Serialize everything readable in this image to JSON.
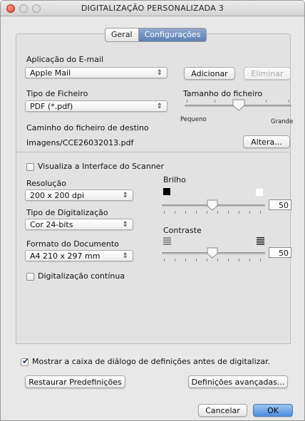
{
  "window": {
    "title": "DIGITALIZAÇÃO PERSONALIZADA 3"
  },
  "tabs": [
    {
      "label": "Geral",
      "active": false
    },
    {
      "label": "Configurações",
      "active": true
    }
  ],
  "email_app": {
    "label": "Aplicação do E-mail",
    "selected": "Apple Mail",
    "add_button": "Adicionar",
    "remove_button": "Eliminar"
  },
  "file_type": {
    "label": "Tipo de Ficheiro",
    "selected": "PDF (*.pdf)"
  },
  "file_size": {
    "label": "Tamanho do ficheiro",
    "min_label": "Pequeno",
    "max_label": "Grande",
    "level": 0.5
  },
  "destination": {
    "label": "Caminho do ficheiro de destino",
    "path": "Imagens/CCE26032013.pdf",
    "change_button": "Altera..."
  },
  "scanner_ui": {
    "label": "Visualiza a Interface do Scanner",
    "checked": false
  },
  "resolution": {
    "label": "Resolução",
    "selected": "200 x 200 dpi"
  },
  "scan_type": {
    "label": "Tipo de Digitalização",
    "selected": "Cor 24-bits"
  },
  "document_size": {
    "label": "Formato do Documento",
    "selected": "A4 210 x 297 mm"
  },
  "continuous_scan": {
    "label": "Digitalização contínua",
    "checked": false
  },
  "brightness": {
    "label": "Brilho",
    "value": "50",
    "level": 0.5
  },
  "contrast": {
    "label": "Contraste",
    "value": "50",
    "level": 0.5
  },
  "show_dialog": {
    "label": "Mostrar a caixa de diálogo de definições antes de digitalizar.",
    "checked": true
  },
  "footer": {
    "restore_button": "Restaurar Predefinições",
    "advanced_button": "Definições avançadas...",
    "cancel_button": "Cancelar",
    "ok_button": "OK"
  },
  "colors": {
    "accent": "#4a8ee0",
    "close": "#d8412e"
  },
  "icons": {
    "stepper": "updown-arrows-icon",
    "brightness_low": "black-square-icon",
    "brightness_high": "white-square-icon",
    "contrast_low": "low-contrast-icon",
    "contrast_high": "high-contrast-icon"
  }
}
